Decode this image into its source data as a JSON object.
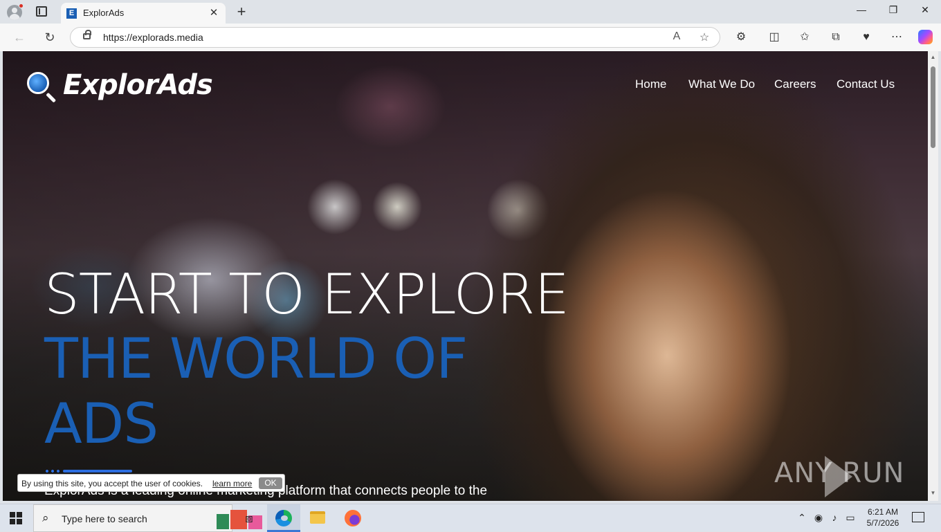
{
  "browser": {
    "tab_title": "ExplorAds",
    "tab_favicon_letter": "E",
    "url": "https://explorads.media",
    "new_tab_label": "+",
    "close_tab_label": "✕"
  },
  "site": {
    "logo_text": "ExplorAds",
    "nav": [
      "Home",
      "What We Do",
      "Careers",
      "Contact Us"
    ],
    "hero": {
      "line1": "START TO EXPLORE",
      "line2": "THE WORLD OF",
      "line3": "ADS",
      "description": "ExplorAds is a leading online marketing  platform that connects people to the"
    },
    "cookie": {
      "text": "By using this site, you accept the user of cookies.",
      "link": "learn more",
      "button": "OK"
    },
    "watermark": "ANY  RUN"
  },
  "taskbar": {
    "search_placeholder": "Type here to search",
    "time": "6:21 AM",
    "date": "5/7/2026"
  },
  "colors": {
    "accent_blue": "#1a5fb4",
    "progress_blue": "#2c6ee0"
  }
}
